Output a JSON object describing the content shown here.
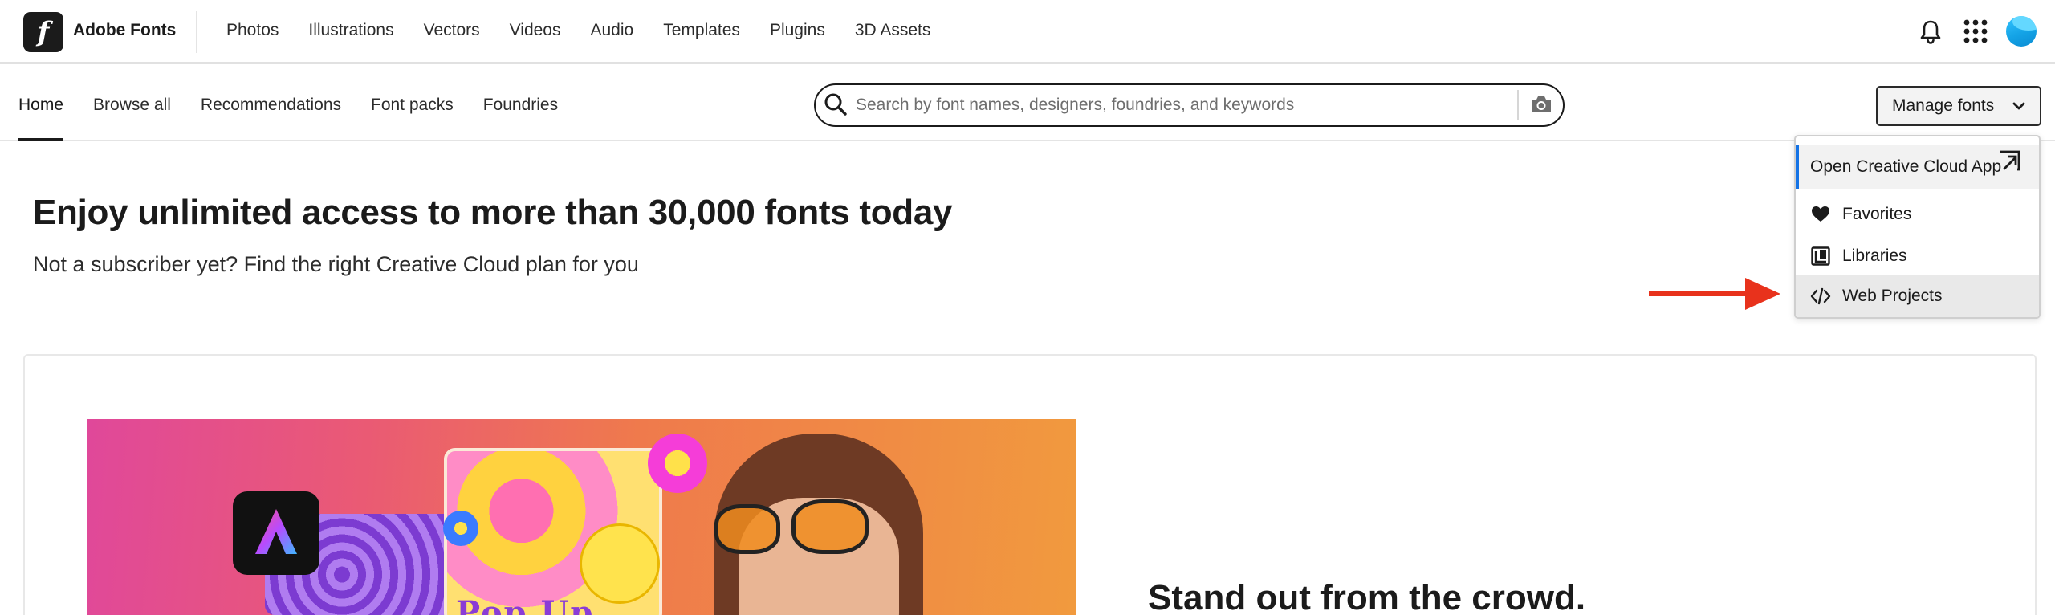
{
  "brand": {
    "logo_letter": "f",
    "name": "Adobe Fonts"
  },
  "top_nav": [
    "Photos",
    "Illustrations",
    "Vectors",
    "Videos",
    "Audio",
    "Templates",
    "Plugins",
    "3D Assets"
  ],
  "sub_nav": {
    "tabs": [
      "Home",
      "Browse all",
      "Recommendations",
      "Font packs",
      "Foundries"
    ],
    "active": "Home"
  },
  "search": {
    "placeholder": "Search by font names, designers, foundries, and keywords"
  },
  "manage_fonts": {
    "label": "Manage fonts",
    "menu": [
      "Open Creative Cloud App",
      "Favorites",
      "Libraries",
      "Web Projects"
    ],
    "highlighted": "Web Projects"
  },
  "hero": {
    "title": "Enjoy unlimited access to more than 30,000 fonts today",
    "subtitle": "Not a subscriber yet? Find the right Creative Cloud plan for you"
  },
  "promo": {
    "poster_text": "Pop Up",
    "title": "Stand out from the crowd."
  },
  "colors": {
    "accent_blue": "#1473e6",
    "annotation_red": "#e8321c",
    "text_dark": "#1b1b1b"
  },
  "icons": [
    "adobe-fonts-logo-icon",
    "bell-icon",
    "app-grid-icon",
    "avatar",
    "search-icon",
    "camera-icon",
    "chevron-down-icon",
    "open-external-icon",
    "heart-icon",
    "library-icon",
    "code-icon",
    "red-arrow-icon"
  ]
}
